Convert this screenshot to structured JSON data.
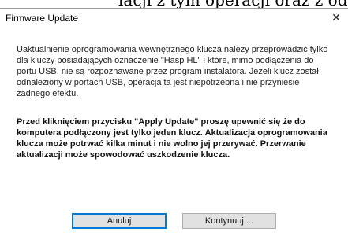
{
  "background_text": "lacji z tym operacji oraz z odpow",
  "dialog": {
    "title": "Firmware Update",
    "close_glyph": "✕",
    "paragraph1": "Uaktualnienie oprogramowania wewnętrznego klucza należy przeprowadzić tylko dla kluczy posiadających oznaczenie \"Hasp HL\" i które, mimo podłączenia do portu USB, nie są rozpoznawane przez program instalatora. Jeżeli klucz został odnaleziony w portach USB, operacja ta jest niepotrzebna i nie przyniesie żadnego efektu.",
    "paragraph2": "Przed kliknięciem przycisku \"Apply Update\" proszę upewnić się że do komputera podłączony jest tylko jeden klucz. Aktualizacja oprogramowania klucza może potrwać kilka minut i nie wolno jej przerywać. Przerwanie aktualizacji może spowodować uszkodzenie klucza.",
    "cancel_label": "Anuluj",
    "continue_label": "Kontynuuj ..."
  }
}
